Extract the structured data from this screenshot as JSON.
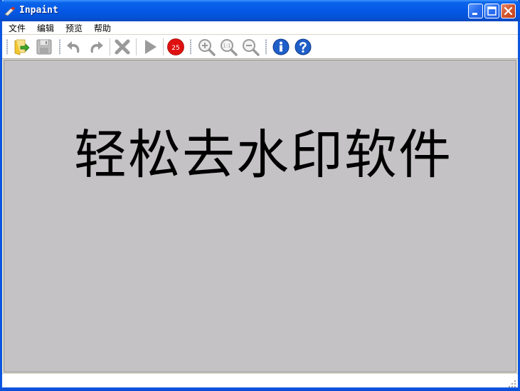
{
  "window": {
    "title": "Inpaint"
  },
  "menu": {
    "items": [
      {
        "label": "文件"
      },
      {
        "label": "编辑"
      },
      {
        "label": "预览"
      },
      {
        "label": "帮助"
      }
    ]
  },
  "toolbar": {
    "icons": [
      "open-folder-icon",
      "save-icon",
      "undo-icon",
      "redo-icon",
      "delete-icon",
      "run-icon",
      "brush-size-icon",
      "zoom-in-icon",
      "zoom-actual-icon",
      "zoom-out-icon",
      "info-icon",
      "help-icon"
    ],
    "brush_size": "25"
  },
  "canvas": {
    "text": "轻松去水印软件"
  },
  "colors": {
    "canvas_bg": "#c4c2c4",
    "titlebar": "#0558e6",
    "accent_red": "#e01010",
    "info_blue": "#1f5fc8"
  }
}
